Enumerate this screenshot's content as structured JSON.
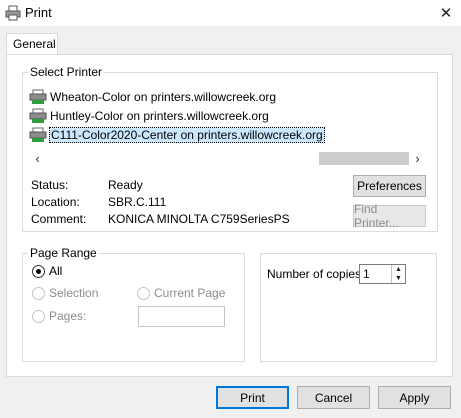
{
  "window": {
    "title": "Print",
    "close_glyph": "✕"
  },
  "tabs": [
    {
      "label": "General"
    }
  ],
  "select_printer": {
    "title": "Select Printer",
    "printers": [
      {
        "name": "Wheaton-Color on printers.willowcreek.org",
        "selected": false
      },
      {
        "name": "Huntley-Color on printers.willowcreek.org",
        "selected": false
      },
      {
        "name": "C111-Color2020-Center on printers.willowcreek.org",
        "selected": true
      }
    ],
    "scroll_left": "‹",
    "scroll_right": "›",
    "status_label": "Status:",
    "status_value": "Ready",
    "location_label": "Location:",
    "location_value": "SBR.C.111",
    "comment_label": "Comment:",
    "comment_value": "KONICA MINOLTA C759SeriesPS",
    "preferences_label": "Preferences",
    "find_printer_label": "Find Printer..."
  },
  "page_range": {
    "title": "Page Range",
    "all_label": "All",
    "selection_label": "Selection",
    "current_page_label": "Current Page",
    "pages_label": "Pages:",
    "pages_value": ""
  },
  "copies": {
    "label": "Number of copies:",
    "value": "1"
  },
  "footer": {
    "print_label": "Print",
    "cancel_label": "Cancel",
    "apply_label": "Apply"
  },
  "colors": {
    "accent": "#0078d7",
    "selection_bg": "#cce8ff",
    "printer_icon_green": "#2e9e3e"
  }
}
